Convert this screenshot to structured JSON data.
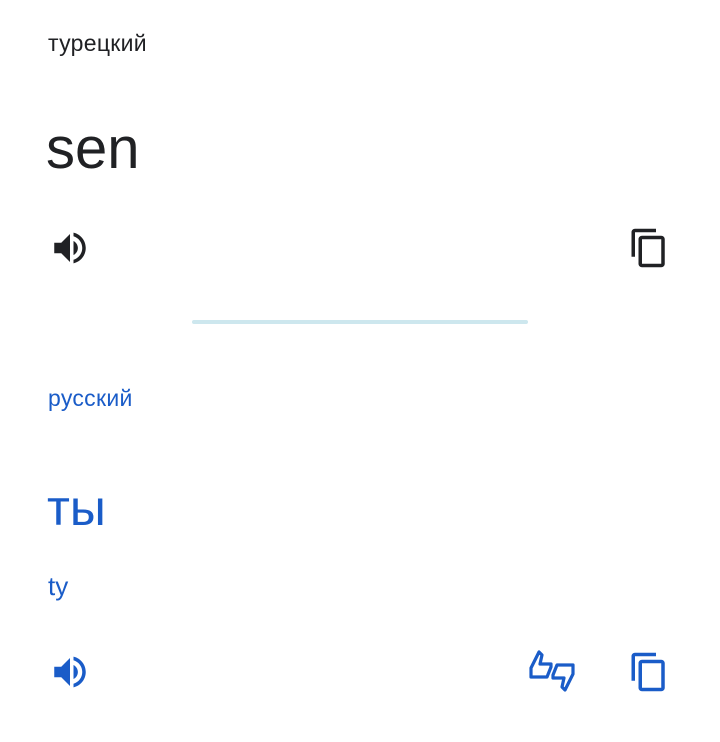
{
  "colors": {
    "dark": "#202124",
    "accent": "#1a5cc8",
    "divider": "#cde7ee",
    "background": "#ffffff"
  },
  "source": {
    "language": "турецкий",
    "text": "sen",
    "icons": {
      "speaker": "speaker-icon",
      "copy": "copy-icon"
    }
  },
  "target": {
    "language": "русский",
    "text": "ты",
    "transliteration": "ty",
    "icons": {
      "speaker": "speaker-icon",
      "feedback": "thumbs-feedback-icon",
      "copy": "copy-icon"
    }
  }
}
